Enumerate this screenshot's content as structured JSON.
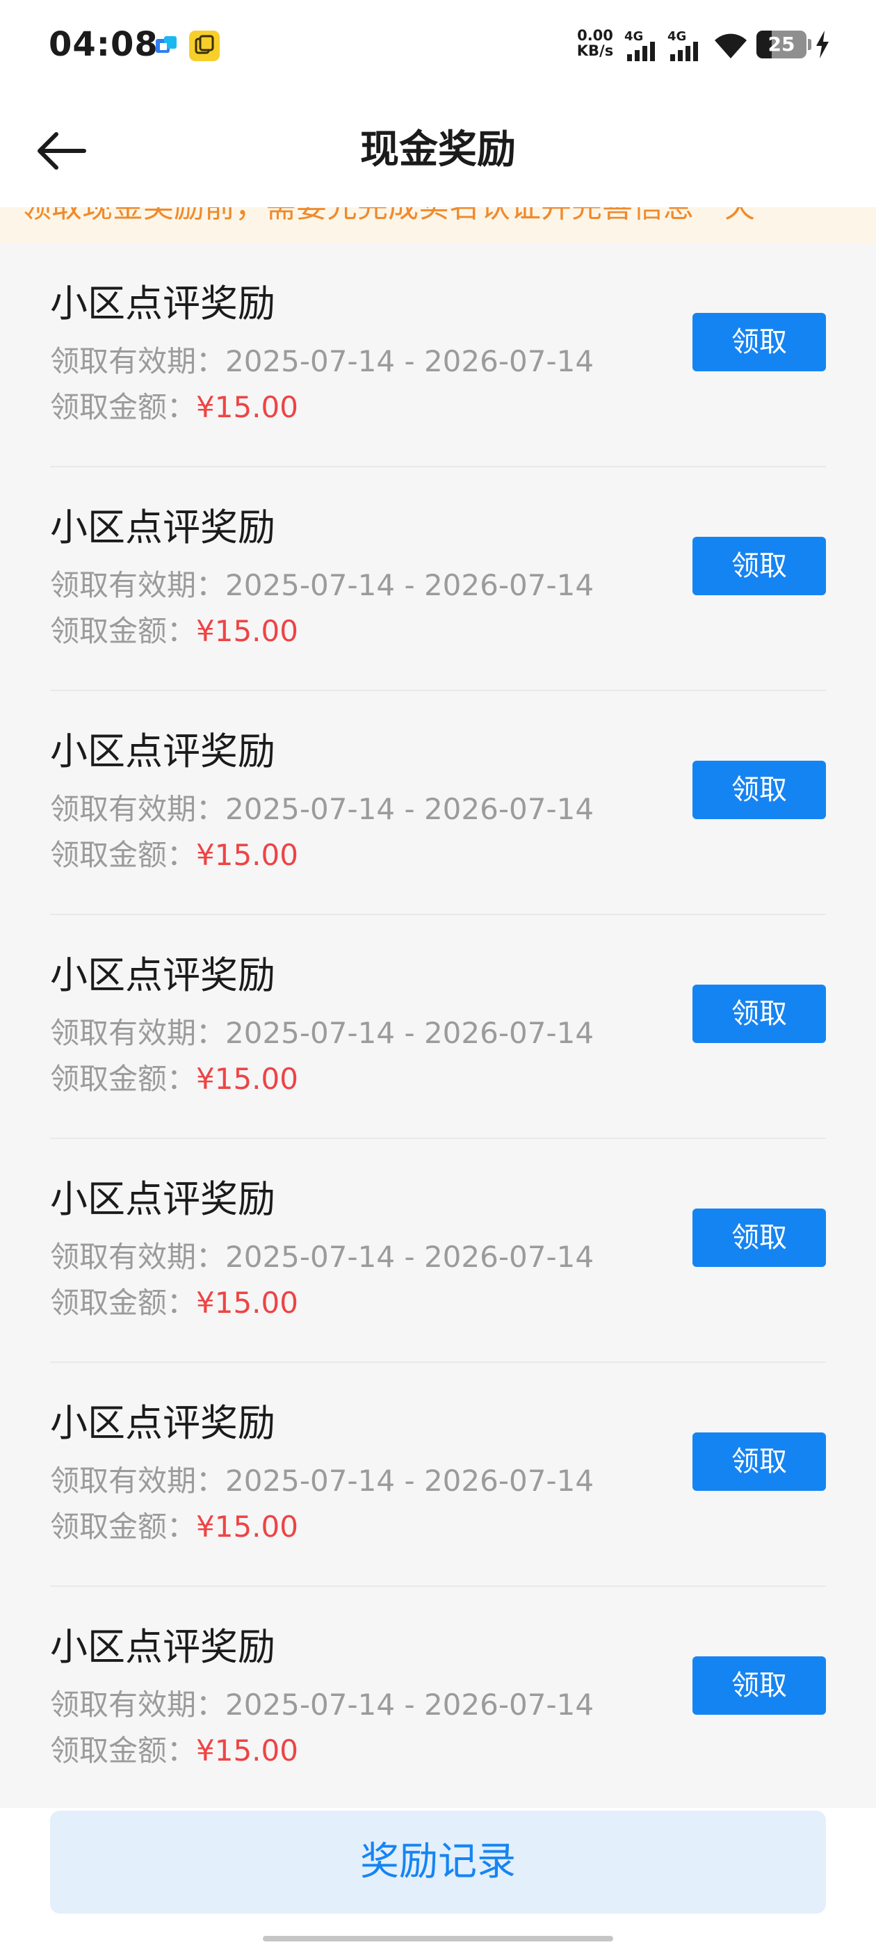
{
  "status_bar": {
    "time": "04:08",
    "net_speed_value": "0.00",
    "net_speed_unit": "KB/s",
    "signal_1_label": "4G",
    "signal_2_label": "4G",
    "battery_level": "25",
    "icons": [
      "app-notification-icon",
      "copy-app-icon",
      "signal-icon",
      "wifi-icon",
      "battery-icon",
      "charging-icon"
    ]
  },
  "nav": {
    "title": "现金奖励",
    "back_icon": "arrow-left-icon"
  },
  "notice": {
    "text": "领取现金奖励前，需要先完成实名认证并完善信息一天"
  },
  "rewards": [
    {
      "title": "小区点评奖励",
      "validity_label": "领取有效期：",
      "validity_range": "2025-07-14 - 2026-07-14",
      "amount_label": "领取金额：",
      "amount": "¥15.00",
      "button": "领取"
    },
    {
      "title": "小区点评奖励",
      "validity_label": "领取有效期：",
      "validity_range": "2025-07-14 - 2026-07-14",
      "amount_label": "领取金额：",
      "amount": "¥15.00",
      "button": "领取"
    },
    {
      "title": "小区点评奖励",
      "validity_label": "领取有效期：",
      "validity_range": "2025-07-14 - 2026-07-14",
      "amount_label": "领取金额：",
      "amount": "¥15.00",
      "button": "领取"
    },
    {
      "title": "小区点评奖励",
      "validity_label": "领取有效期：",
      "validity_range": "2025-07-14 - 2026-07-14",
      "amount_label": "领取金额：",
      "amount": "¥15.00",
      "button": "领取"
    },
    {
      "title": "小区点评奖励",
      "validity_label": "领取有效期：",
      "validity_range": "2025-07-14 - 2026-07-14",
      "amount_label": "领取金额：",
      "amount": "¥15.00",
      "button": "领取"
    },
    {
      "title": "小区点评奖励",
      "validity_label": "领取有效期：",
      "validity_range": "2025-07-14 - 2026-07-14",
      "amount_label": "领取金额：",
      "amount": "¥15.00",
      "button": "领取"
    },
    {
      "title": "小区点评奖励",
      "validity_label": "领取有效期：",
      "validity_range": "2025-07-14 - 2026-07-14",
      "amount_label": "领取金额：",
      "amount": "¥15.00",
      "button": "领取"
    }
  ],
  "bottom": {
    "records_button": "奖励记录"
  },
  "colors": {
    "primary": "#1584f3",
    "amount": "#ee4444",
    "notice_text": "#f08a2c",
    "notice_bg": "#fdf6e8"
  }
}
